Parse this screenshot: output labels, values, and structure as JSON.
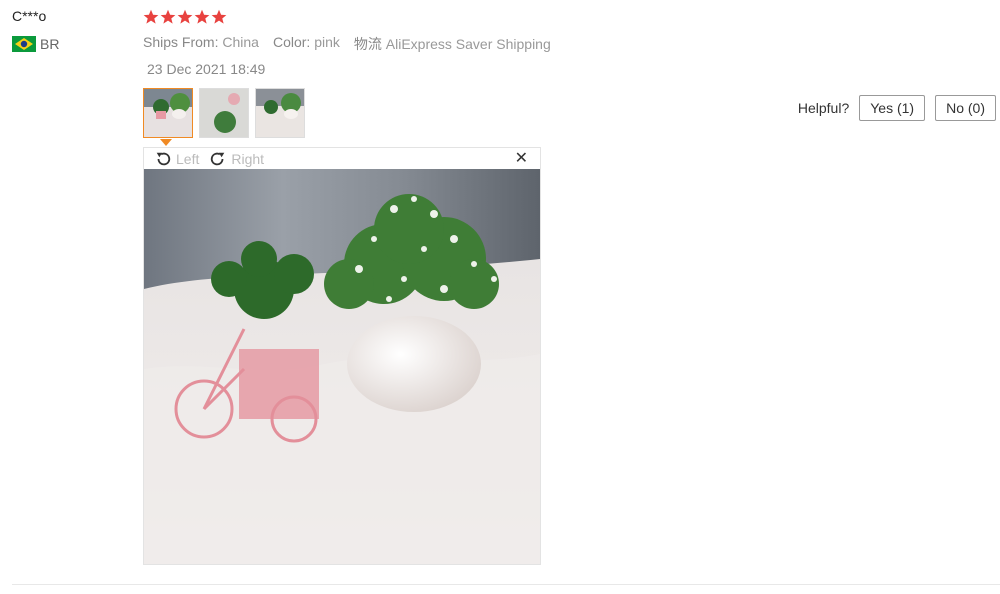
{
  "review": {
    "username": "C***o",
    "country": "BR",
    "rating": 5,
    "ships_from_label": "Ships From:",
    "ships_from_value": "China",
    "color_label": "Color:",
    "color_value": "pink",
    "logistics_label": "物流",
    "logistics_value": "AliExpress Saver Shipping",
    "date": "23 Dec 2021 18:49"
  },
  "viewer": {
    "rotate_left_label": "Left",
    "rotate_right_label": "Right",
    "close_glyph": "✕"
  },
  "helpful": {
    "label": "Helpful?",
    "yes_label": "Yes (1)",
    "no_label": "No (0)"
  },
  "colors": {
    "star": "#e8423f",
    "flag_green": "#0b9a3c",
    "flag_yellow": "#f7d117",
    "flag_blue": "#1f3c88",
    "active_thumb": "#f08a24"
  },
  "icons": [
    "star-icon",
    "brazil-flag-icon",
    "rotate-left-icon",
    "rotate-right-icon",
    "close-icon"
  ]
}
